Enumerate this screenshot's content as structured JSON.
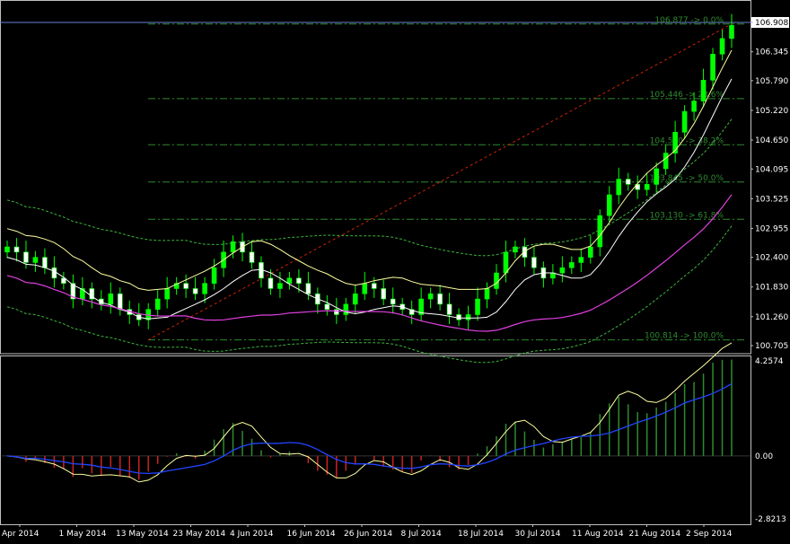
{
  "chart_data": [
    {
      "type": "candlestick",
      "title": "",
      "price_labels": [
        "106.908",
        "106.345",
        "105.790",
        "105.220",
        "104.650",
        "104.095",
        "103.525",
        "102.955",
        "102.400",
        "101.830",
        "101.260",
        "100.705"
      ],
      "current_price": "106.908",
      "ylim": [
        100.705,
        106.908
      ],
      "dates": [
        "Apr 2014",
        "1 May 2014",
        "13 May 2014",
        "23 May 2014",
        "4 Jun 2014",
        "16 Jun 2014",
        "26 Jun 2014",
        "8 Jul 2014",
        "18 Jul 2014",
        "30 Jul 2014",
        "11 Aug 2014",
        "21 Aug 2014",
        "2 Sep 2014"
      ],
      "fibonacci": [
        {
          "price": 106.877,
          "label": "106.877 -> 0.0%"
        },
        {
          "price": 105.446,
          "label": "105.446 -> 23.6%"
        },
        {
          "price": 104.56,
          "label": "104.560 -> 38.2%"
        },
        {
          "price": 103.845,
          "label": "103.845 -> 50.0%"
        },
        {
          "price": 103.13,
          "label": "103.130 -> 61.8%"
        },
        {
          "price": 100.814,
          "label": "100.814 -> 100.0%"
        }
      ],
      "fib_trendline": {
        "from": 100.814,
        "to": 106.877
      },
      "close": [
        102.6,
        102.5,
        102.3,
        102.4,
        102.2,
        102.0,
        101.9,
        101.6,
        101.8,
        101.6,
        101.5,
        101.7,
        101.4,
        101.3,
        101.2,
        101.4,
        101.6,
        101.8,
        101.9,
        101.8,
        101.7,
        101.9,
        102.2,
        102.5,
        102.7,
        102.5,
        102.3,
        102.0,
        101.8,
        101.9,
        102.0,
        101.9,
        101.7,
        101.5,
        101.4,
        101.3,
        101.5,
        101.7,
        101.9,
        101.8,
        101.6,
        101.5,
        101.4,
        101.3,
        101.6,
        101.7,
        101.5,
        101.3,
        101.2,
        101.3,
        101.6,
        101.8,
        102.1,
        102.5,
        102.6,
        102.4,
        102.2,
        102.0,
        102.1,
        102.2,
        102.3,
        102.4,
        102.6,
        103.2,
        103.6,
        103.9,
        103.8,
        103.7,
        103.8,
        104.1,
        104.4,
        104.8,
        105.2,
        105.4,
        105.8,
        106.3,
        106.6,
        106.85
      ],
      "colors": {
        "bull": "#00FF00",
        "bear": "#FFFFFF",
        "fib": "#2E8B2E",
        "trend": "#CC2200",
        "upper_band": "#FFFFA0",
        "lower_band": "#FFFFFF",
        "magenta": "#E040E0",
        "dotted": "#3CB43C"
      }
    },
    {
      "type": "histogram",
      "labels": [
        "4.2574",
        "0.00",
        "-2.8213"
      ],
      "ylim": [
        -2.8213,
        4.2574
      ],
      "colors": {
        "up": "#2E8B2E",
        "down": "#CC2222",
        "fast": "#FFFFA0",
        "slow": "#2244FF"
      }
    }
  ]
}
